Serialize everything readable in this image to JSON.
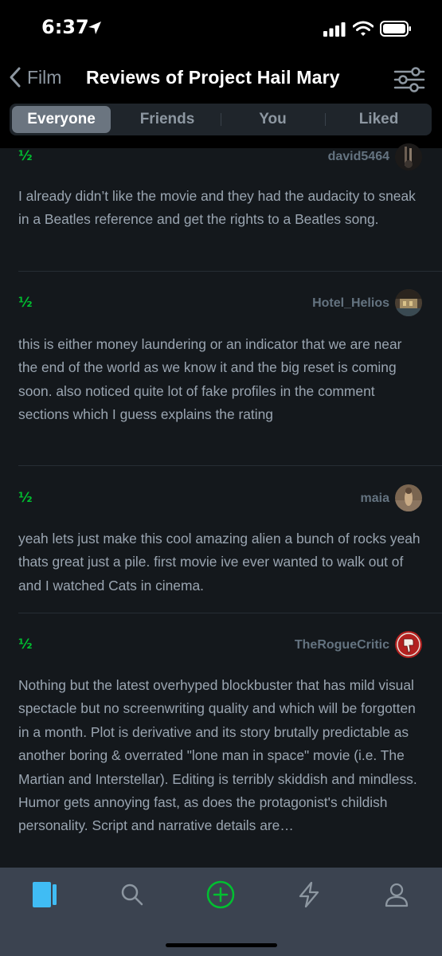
{
  "status_bar": {
    "time": "6:37"
  },
  "nav": {
    "back_label": "Film",
    "title": "Reviews of Project Hail Mary"
  },
  "segments": [
    {
      "label": "Everyone",
      "active": true
    },
    {
      "label": "Friends",
      "active": false
    },
    {
      "label": "You",
      "active": false
    },
    {
      "label": "Liked",
      "active": false
    }
  ],
  "reviews": [
    {
      "rating": "½",
      "author": "david5464",
      "text": "I already didn’t like the movie and they had the audacity to sneak in a Beatles reference and get the rights to a Beatles song."
    },
    {
      "rating": "½",
      "author": "Hotel_Helios",
      "text": "this is either money laundering or an indicator that we are near the end of the world as we know it and the big reset is coming soon.  also noticed quite lot of fake profiles in the comment sections which I guess explains the rating"
    },
    {
      "rating": "½",
      "author": "maia",
      "text": "yeah lets just make this cool amazing alien a bunch of rocks yeah thats great just a pile. first movie ive ever wanted to walk out of and I watched Cats in cinema."
    },
    {
      "rating": "½",
      "author": "TheRogueCritic",
      "text": "Nothing but the latest overhyped blockbuster that has mild visual spectacle but no screenwriting quality and which will be forgotten in a month. Plot is derivative and its story brutally predictable as another boring & overrated \"lone man in space\" movie (i.e. The Martian and Interstellar). Editing is terribly skiddish and mindless. Humor gets annoying fast, as does the protagonist's childish personality. Script and narrative details are…"
    }
  ],
  "tab_bar": {
    "items": [
      {
        "icon": "films-icon",
        "active": true
      },
      {
        "icon": "search-icon",
        "active": false
      },
      {
        "icon": "add-icon",
        "active": false
      },
      {
        "icon": "activity-icon",
        "active": false
      },
      {
        "icon": "profile-icon",
        "active": false
      }
    ]
  },
  "colors": {
    "background": "#14181c",
    "rating_green": "#00c030",
    "accent_blue": "#40bcf4",
    "tab_bar": "#3b4350"
  }
}
